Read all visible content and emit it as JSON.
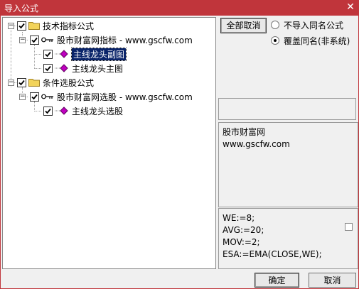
{
  "window": {
    "title": "导入公式",
    "close_glyph": "✕"
  },
  "tree": {
    "groups": [
      {
        "label": "技术指标公式",
        "expander": "−",
        "source": {
          "label": "股市财富网指标 - www.gscfw.com",
          "expander": "−"
        },
        "items": [
          {
            "label": "主线龙头副图",
            "selected": true
          },
          {
            "label": "主线龙头主图",
            "selected": false
          }
        ]
      },
      {
        "label": "条件选股公式",
        "expander": "−",
        "source": {
          "label": "股市财富网选股 - www.gscfw.com",
          "expander": "−"
        },
        "items": [
          {
            "label": "主线龙头选股",
            "selected": false
          }
        ]
      }
    ]
  },
  "actions": {
    "cancel_all": "全部取消",
    "ok": "确定",
    "cancel": "取消"
  },
  "options": [
    {
      "label": "不导入同名公式",
      "checked": false
    },
    {
      "label": "覆盖同名(非系统)",
      "checked": true
    }
  ],
  "info": {
    "line1": "股市财富网",
    "line2": "www.gscfw.com"
  },
  "code": {
    "lines": [
      "WE:=8;",
      "AVG:=20;",
      "MOV:=2;",
      "ESA:=EMA(CLOSE,WE);"
    ]
  },
  "colors": {
    "titlebar": "#c0353b",
    "selection": "#0a246a",
    "folder": "#f2d35a",
    "formula": "#c000c0"
  }
}
